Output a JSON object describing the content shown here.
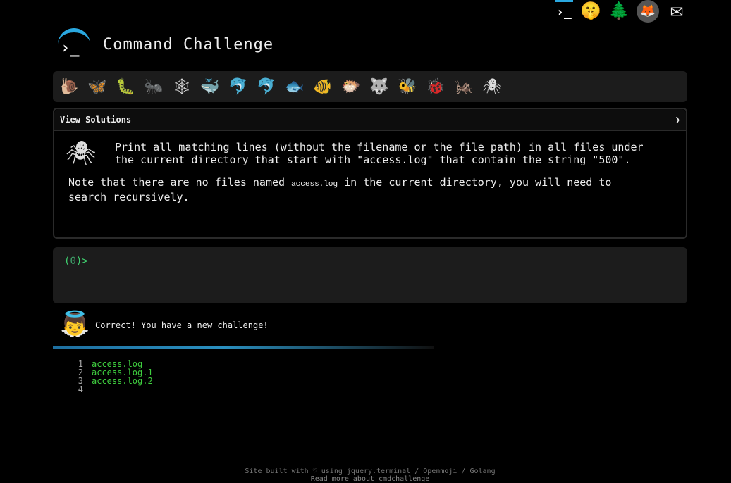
{
  "top_icons": [
    {
      "name": "terminal-icon",
      "glyph": "›_"
    },
    {
      "name": "shushing-face-icon",
      "glyph": "🤫"
    },
    {
      "name": "tree-icon",
      "glyph": "🌲"
    },
    {
      "name": "gitlab-icon",
      "glyph": "🦊"
    },
    {
      "name": "mail-icon",
      "glyph": "✉"
    }
  ],
  "brand": {
    "title": "Command Challenge",
    "logo_glyph": "›_"
  },
  "critters": [
    "🐌",
    "🦋",
    "🐛",
    "🐜",
    "🕸",
    "🐳",
    "🐬",
    "🐬",
    "🐟",
    "🐠",
    "🐡",
    "🐺",
    "🐝",
    "🐞",
    "🦗",
    "🕷"
  ],
  "solutions": {
    "label": "View Solutions",
    "chevron": "❯"
  },
  "challenge": {
    "icon_glyph": "🕷",
    "task": "Print all matching lines (without the filename or the file path) in all files under the current directory that start with \"access.log\" that contain the string \"500\".",
    "note_before": "Note that there are no files named ",
    "note_code": "access.log",
    "note_after": " in the current directory, you will need to search recursively."
  },
  "terminal": {
    "open": "(",
    "count": "0",
    "close": ")>"
  },
  "status": {
    "icon_glyph": "👼",
    "message": "Correct! You have a new challenge!"
  },
  "files": [
    {
      "line": "1",
      "name": "access.log"
    },
    {
      "line": "2",
      "name": "access.log.1"
    },
    {
      "line": "3",
      "name": "access.log.2"
    },
    {
      "line": "4",
      "name": ""
    }
  ],
  "footer": {
    "line1": "Site built with ♡ using jquery.terminal / Openmoji / Golang",
    "line2": "Read more about cmdchallenge"
  },
  "colors": {
    "accent": "#2aa8e0",
    "prompt_green": "#3fcf6f",
    "file_green": "#3fcf3f"
  }
}
